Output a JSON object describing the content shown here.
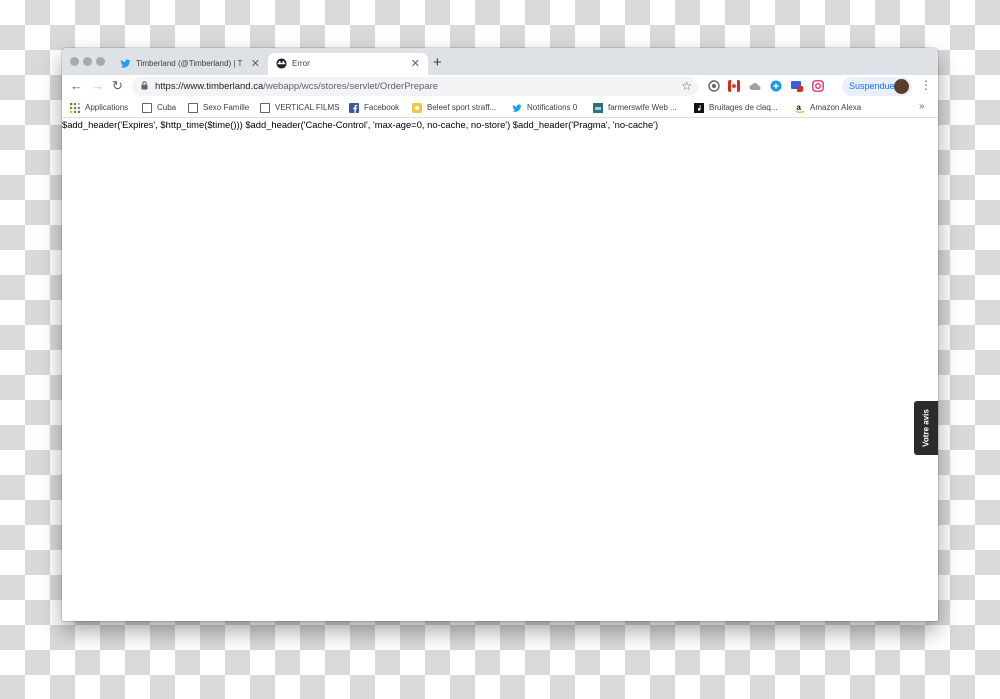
{
  "tabs": [
    {
      "title": "Timberland (@Timberland) | Tw",
      "icon": "twitter-icon",
      "active": false
    },
    {
      "title": "Error",
      "icon": "error-icon",
      "active": true
    }
  ],
  "toolbar": {
    "url_host": "https://www.timberland.ca",
    "url_path": "/webapp/wcs/stores/servlet/OrderPrepare",
    "profile_label": "Suspendue"
  },
  "bookmarks": [
    {
      "label": "Applications",
      "icon": "apps-grid-icon"
    },
    {
      "label": "Cuba",
      "icon": "folder-icon"
    },
    {
      "label": "Sexo Famille",
      "icon": "folder-icon"
    },
    {
      "label": "VERTICAL FILMS",
      "icon": "folder-icon"
    },
    {
      "label": "Facebook",
      "icon": "facebook-icon"
    },
    {
      "label": "Beleef sport straff...",
      "icon": "site-icon"
    },
    {
      "label": "Notifications 0",
      "icon": "twitter-icon"
    },
    {
      "label": "farmerswife Web ...",
      "icon": "farmerswife-icon"
    },
    {
      "label": "Bruitages de claq...",
      "icon": "music-icon"
    },
    {
      "label": "Amazon Alexa",
      "icon": "amazon-icon"
    }
  ],
  "content": {
    "code_text": "$add_header('Expires', $http_time($time())) $add_header('Cache-Control', 'max-age=0, no-cache, no-store') $add_header('Pragma', 'no-cache')"
  },
  "feedback": {
    "label": "Votre avis"
  },
  "colors": {
    "twitter": "#1da1f2",
    "facebook": "#3b5998",
    "profile_bg": "#e8f0fe",
    "feedback_bg": "#2b2b2b"
  }
}
